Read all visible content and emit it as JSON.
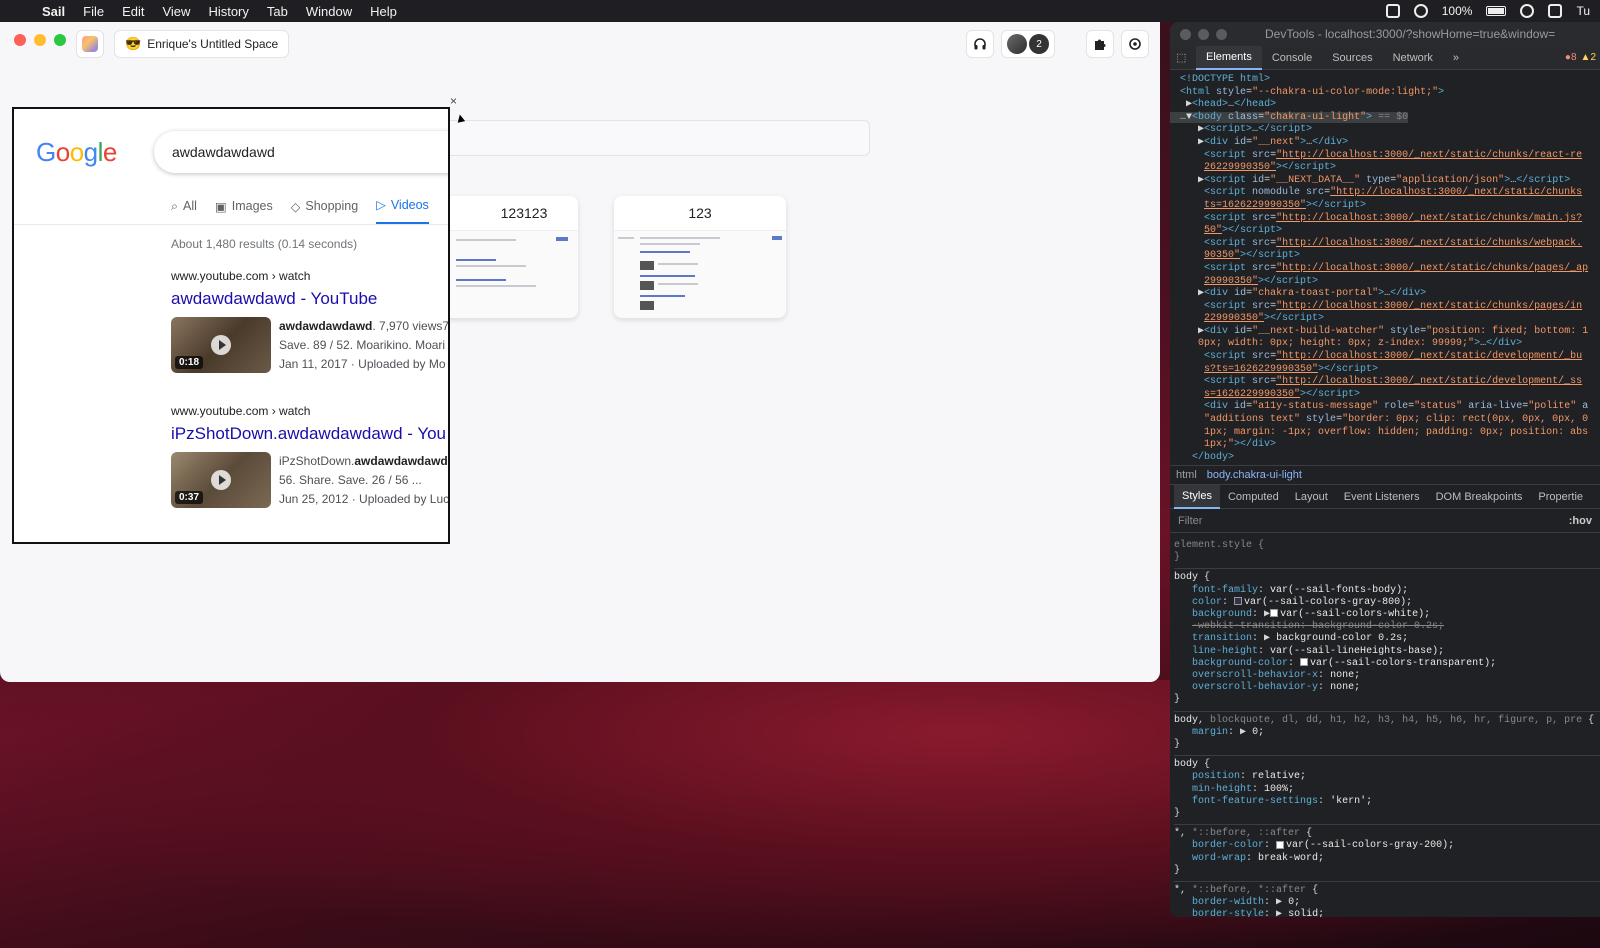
{
  "menubar": {
    "app": "Sail",
    "items": [
      "File",
      "Edit",
      "View",
      "History",
      "Tab",
      "Window",
      "Help"
    ],
    "battery": "100%",
    "clock": "Tu"
  },
  "sail": {
    "space_emoji": "😎",
    "space_name": "Enrique's Untitled Space",
    "avatar_count": "2",
    "tabs": [
      {
        "title": "123123"
      },
      {
        "title": "123"
      }
    ]
  },
  "popup": {
    "close": "×",
    "search_query": "awdawdawdawd",
    "tabs": [
      "All",
      "Images",
      "Shopping",
      "Videos"
    ],
    "stats": "About 1,480 results (0.14 seconds)",
    "results": [
      {
        "cite": "www.youtube.com › watch",
        "title": "awdawdawdawd - YouTube",
        "duration": "0:18",
        "snippet_bold": "awdawdawdawd",
        "snippet_line1_rest": ". 7,970 views7.",
        "snippet_line2": "Save. 89 / 52. Moarikino. Moari",
        "snippet_line3": "Jan 11, 2017 · Uploaded by Mo"
      },
      {
        "cite": "www.youtube.com › watch",
        "title": "iPzShotDown.awdawdawdawd - You",
        "duration": "0:37",
        "snippet_line1_pre": "iPzShotDown.",
        "snippet_bold": "awdawdawdawd",
        "snippet_line1_rest": ".",
        "snippet_line2": "56. Share. Save. 26 / 56 ...",
        "snippet_line3": "Jun 25, 2012 · Uploaded by Luc"
      }
    ]
  },
  "devtools": {
    "window_title": "DevTools - localhost:3000/?showHome=true&window=",
    "tabs": [
      "Elements",
      "Console",
      "Sources",
      "Network",
      "»"
    ],
    "errors": "8",
    "warnings": "2",
    "breadcrumbs": [
      "html",
      "body.chakra-ui-light"
    ],
    "sub_tabs": [
      "Styles",
      "Computed",
      "Layout",
      "Event Listeners",
      "DOM Breakpoints",
      "Propertie"
    ],
    "filter_placeholder": "Filter",
    "hov": ":hov"
  }
}
